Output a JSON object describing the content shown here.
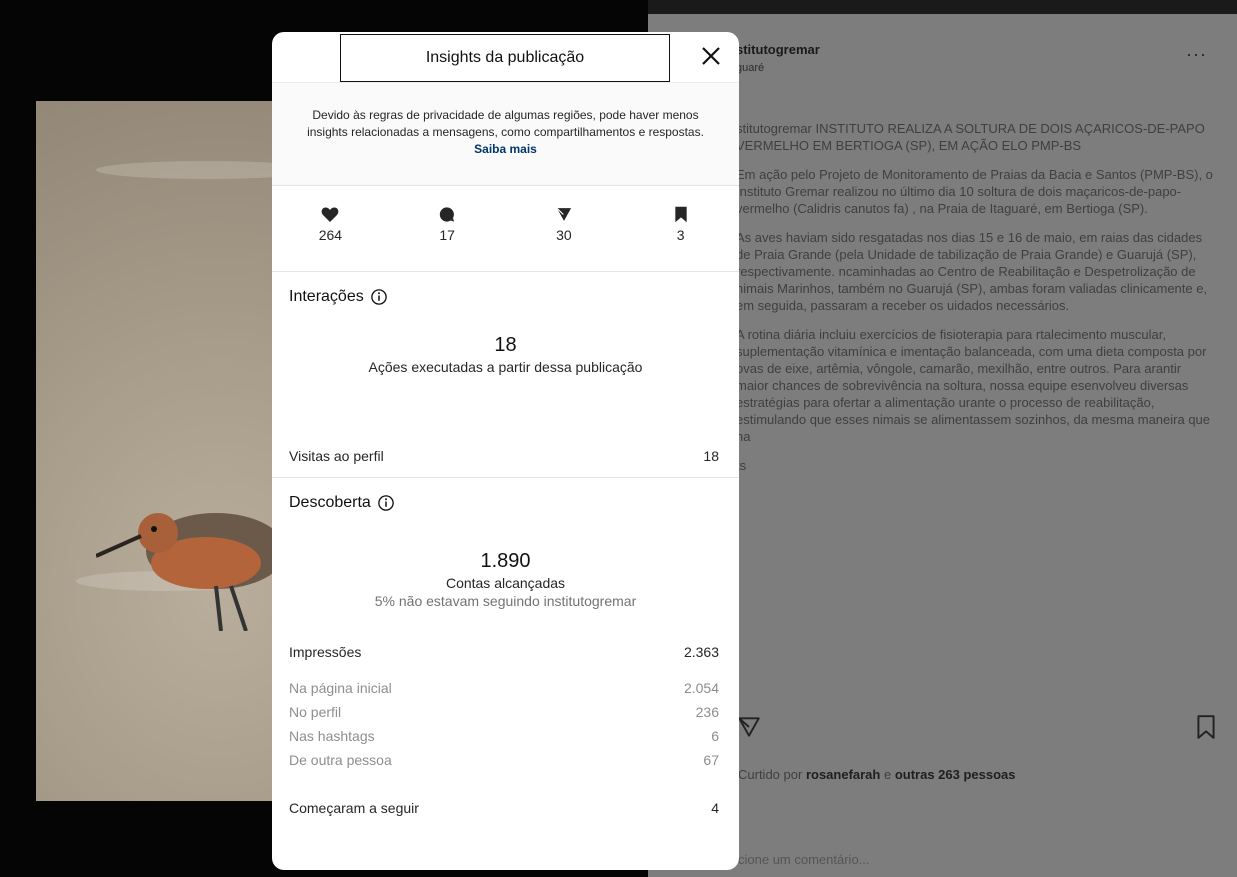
{
  "modal": {
    "title": "Insights da publicação",
    "privacy_text": "Devido às regras de privacidade de algumas regiões, pode haver menos insights relacionadas a mensagens, como compartilhamentos e respostas.",
    "privacy_link": "Saiba mais",
    "stats": [
      {
        "icon": "heart-icon",
        "value": "264"
      },
      {
        "icon": "comment-icon",
        "value": "17"
      },
      {
        "icon": "share-icon",
        "value": "30"
      },
      {
        "icon": "bookmark-icon",
        "value": "3"
      }
    ],
    "interactions": {
      "title": "Interações",
      "total": "18",
      "total_label": "Ações executadas a partir dessa publicação",
      "profile_visits_label": "Visitas ao perfil",
      "profile_visits_value": "18"
    },
    "discovery": {
      "title": "Descoberta",
      "total": "1.890",
      "total_label": "Contas alcançadas",
      "not_following": "5% não estavam seguindo institutogremar",
      "impressions_label": "Impressões",
      "impressions_value": "2.363",
      "breakdown": [
        {
          "label": "Na página inicial",
          "value": "2.054"
        },
        {
          "label": "No perfil",
          "value": "236"
        },
        {
          "label": "Nas hashtags",
          "value": "6"
        },
        {
          "label": "De outra pessoa",
          "value": "67"
        }
      ],
      "follows_label": "Começaram a seguir",
      "follows_value": "4"
    }
  },
  "post": {
    "username": "stitutogremar",
    "location": "guaré",
    "caption": [
      "stitutogremar INSTITUTO REALIZA A SOLTURA DE DOIS AÇARICOS-DE-PAPO VERMELHO EM BERTIOGA (SP), EM AÇÃO ELO PMP-BS",
      "Em ação pelo Projeto de Monitoramento de Praias da Bacia e Santos (PMP-BS), o Instituto Gremar realizou no último dia 10 soltura de dois maçaricos-de-papo-vermelho (Calidris canutos fa) , na Praia de Itaguaré, em Bertioga (SP).",
      "As aves haviam sido resgatadas nos dias 15 e 16 de maio, em raias das cidades de Praia Grande (pela Unidade de tabilização de Praia Grande) e Guarujá (SP), respectivamente. ncaminhadas ao Centro de Reabilitação e Despetrolização de nimais Marinhos, também no Guarujá (SP), ambas foram valiadas clinicamente e, em seguida, passaram a receber os uidados necessários.",
      "A rotina diária incluiu exercícios de fisioterapia para rtalecimento muscular, suplementação vitamínica e imentação balanceada, com uma dieta composta por ovas de eixe, artêmia, vôngole, camarão, mexilhão, entre outros. Para arantir maior chances de sobrevivência na soltura, nossa equipe esenvolveu diversas estratégias para ofertar a alimentação urante o processo de reabilitação, estimulando que esses nimais se alimentassem sozinhos, da mesma maneira que na"
    ],
    "more": "ts",
    "liked_prefix": "Curtido por",
    "liked_user": "rosanefarah",
    "liked_mid": "e",
    "liked_others": "outras 263 pessoas",
    "comment_placeholder": "cione um comentário..."
  }
}
